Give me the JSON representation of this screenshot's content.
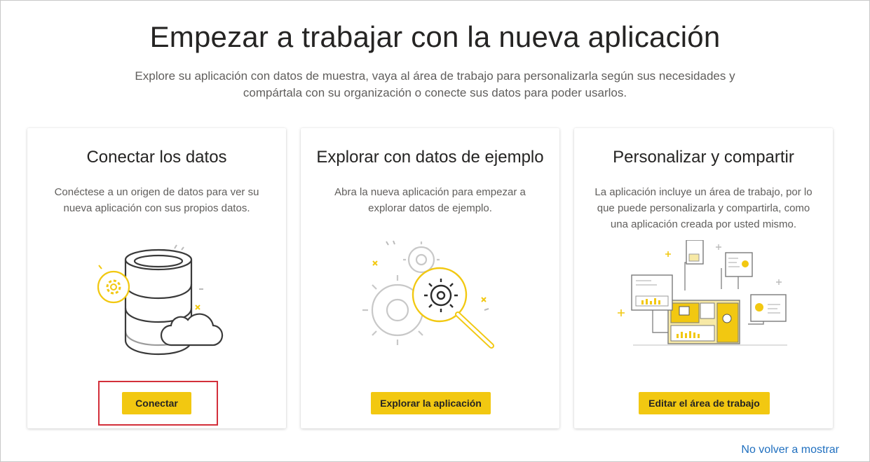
{
  "page": {
    "title": "Empezar a trabajar con la nueva aplicación",
    "subtitle": "Explore su aplicación con datos de muestra, vaya al área de trabajo para personalizarla según sus necesidades y compártala con su organización o conecte sus datos para poder usarlos."
  },
  "cards": [
    {
      "title": "Conectar los datos",
      "description": "Conéctese a un origen de datos para ver su nueva aplicación con sus propios datos.",
      "button": "Conectar",
      "icon": "database-cloud-icon"
    },
    {
      "title": "Explorar con datos de ejemplo",
      "description": "Abra la nueva aplicación para empezar a explorar datos de ejemplo.",
      "button": "Explorar la aplicación",
      "icon": "gears-magnifier-icon"
    },
    {
      "title": "Personalizar y compartir",
      "description": "La aplicación incluye un área de trabajo, por lo que puede personalizarla y compartirla, como una aplicación creada por usted mismo.",
      "button": "Editar el área de trabajo",
      "icon": "workspace-reports-icon"
    }
  ],
  "footer": {
    "dismiss_link": "No volver a mostrar"
  },
  "colors": {
    "accent": "#f2c811",
    "link": "#1f6fbf",
    "highlight": "#d32f3a",
    "text_secondary": "#605e5c"
  }
}
